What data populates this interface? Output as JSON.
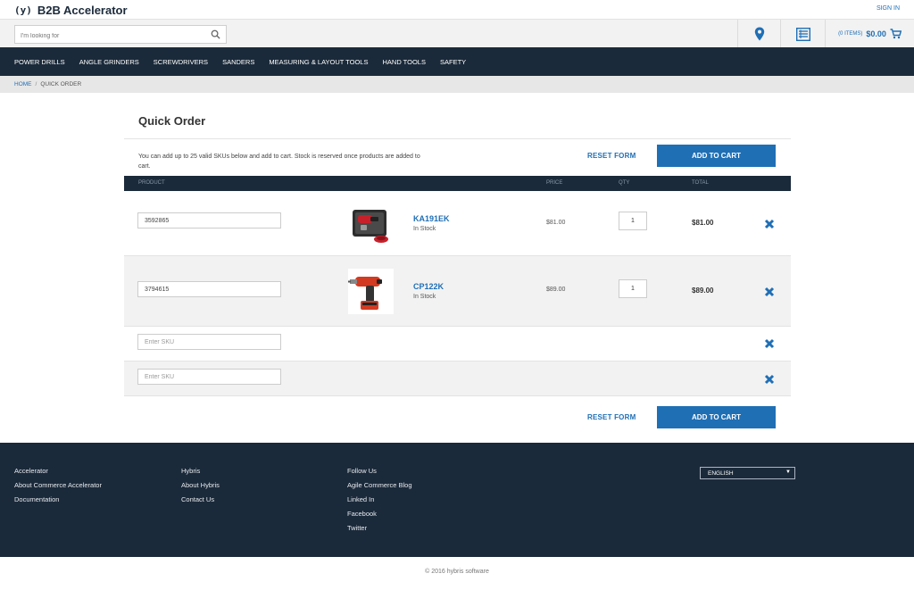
{
  "header": {
    "logo_mark": "(y)",
    "logo_text": "B2B Accelerator",
    "signin_label": "SIGN IN",
    "search_placeholder": "I'm looking for",
    "cart_items": "(0 ITEMS)",
    "cart_total": "$0.00"
  },
  "nav": {
    "items": [
      {
        "label": "POWER DRILLS"
      },
      {
        "label": "ANGLE GRINDERS"
      },
      {
        "label": "SCREWDRIVERS"
      },
      {
        "label": "SANDERS"
      },
      {
        "label": "MEASURING & LAYOUT TOOLS"
      },
      {
        "label": "HAND TOOLS"
      },
      {
        "label": "SAFETY"
      }
    ]
  },
  "breadcrumb": {
    "home": "HOME",
    "separator": "/",
    "current": "QUICK ORDER"
  },
  "main": {
    "title": "Quick Order",
    "intro": "You can add up to 25 valid SKUs below and add to cart. Stock is reserved once products are added to cart.",
    "reset_label": "RESET FORM",
    "add_label": "ADD TO CART",
    "columns": {
      "product": "PRODUCT",
      "price": "PRICE",
      "qty": "QTY",
      "total": "TOTAL"
    },
    "rows": [
      {
        "sku": "3592865",
        "code": "KA191EK",
        "stock": "In Stock",
        "price": "$81.00",
        "qty": "1",
        "total": "$81.00"
      },
      {
        "sku": "3794615",
        "code": "CP122K",
        "stock": "In Stock",
        "price": "$89.00",
        "qty": "1",
        "total": "$89.00"
      }
    ],
    "empty_placeholder": "Enter SKU"
  },
  "footer": {
    "col1": [
      "Accelerator",
      "About Commerce Accelerator",
      "Documentation"
    ],
    "col2": [
      "Hybris",
      "About Hybris",
      "Contact Us"
    ],
    "col3": [
      "Follow Us",
      "Agile Commerce Blog",
      "Linked In",
      "Facebook",
      "Twitter"
    ],
    "language": "ENGLISH",
    "copyright": "© 2016 hybris software"
  },
  "colors": {
    "navy": "#1b2a3a",
    "accent_blue": "#1f6fb5",
    "light_grey": "#f2f2f2"
  },
  "icons": {
    "search": "search-icon",
    "store": "map-pin-icon",
    "list": "list-icon",
    "cart": "cart-icon",
    "remove": "close-x-icon"
  }
}
